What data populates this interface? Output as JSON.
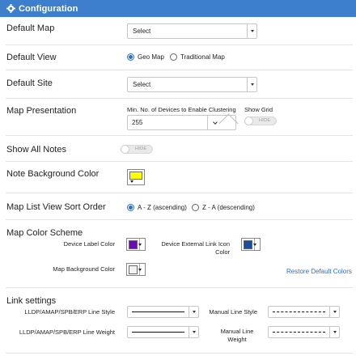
{
  "header": {
    "title": "Configuration",
    "icon": "gear-icon"
  },
  "default_map": {
    "label": "Default Map",
    "value": "Select"
  },
  "default_view": {
    "label": "Default View",
    "options": [
      "Geo Map",
      "Traditional Map"
    ],
    "selected": "Geo Map"
  },
  "default_site": {
    "label": "Default Site",
    "value": "Select"
  },
  "map_presentation": {
    "label": "Map Presentation",
    "clustering_label": "Min. No. of Devices to Enable Clustering",
    "clustering_value": "255",
    "show_grid_label": "Show Grid",
    "show_grid_toggle": "HIDE"
  },
  "show_all_notes": {
    "label": "Show All Notes",
    "toggle": "HIDE"
  },
  "note_background_color": {
    "label": "Note Background Color",
    "color": "#ffff00"
  },
  "map_list_sort": {
    "label": "Map List View Sort Order",
    "options": [
      "A - Z (ascending)",
      "Z - A (descending)"
    ],
    "selected": "A - Z (ascending)"
  },
  "map_color_scheme": {
    "label": "Map Color Scheme",
    "device_label_color_label": "Device Label Color",
    "device_label_color": "#6a0dad",
    "external_link_label": "Device External Link Icon Color",
    "external_link_color": "#1f4e99",
    "map_background_label": "Map Background Color",
    "map_background_color": "#f2f2f2",
    "restore_link": "Restore Default Colors"
  },
  "link_settings": {
    "label": "Link settings",
    "line_style_label": "LLDP/AMAP/SPB/ERP Line Style",
    "manual_line_style_label": "Manual Line Style",
    "line_weight_label": "LLDP/AMAP/SPB/ERP Line Weight",
    "manual_line_weight_label": "Manual Line Weight"
  },
  "colors": {
    "accent": "#3d7fcc",
    "link": "#2a6fc9"
  }
}
